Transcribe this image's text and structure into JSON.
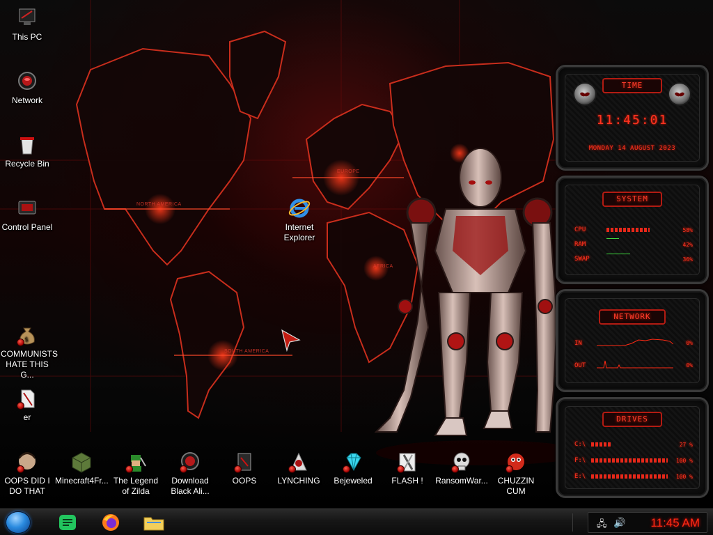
{
  "desktop_icons": [
    {
      "id": "this-pc",
      "label": "This PC",
      "icon": "this-pc-icon"
    },
    {
      "id": "network",
      "label": "Network",
      "icon": "network-icon"
    },
    {
      "id": "recycle-bin",
      "label": "Recycle Bin",
      "icon": "recycle-bin-icon"
    },
    {
      "id": "control-panel",
      "label": "Control Panel",
      "icon": "control-panel-icon"
    },
    {
      "id": "internet-explorer",
      "label": "Internet Explorer",
      "icon": "internet-explorer-icon"
    },
    {
      "id": "communists",
      "label": "COMMUNISTS HATE THIS G...",
      "icon": "money-bag-icon"
    },
    {
      "id": "er",
      "label": "er",
      "icon": "file-icon"
    },
    {
      "id": "oops-did",
      "label": "OOPS DID I DO THAT",
      "icon": "face-icon"
    },
    {
      "id": "minecraft",
      "label": "Minecraft4Fr...",
      "icon": "minecraft-icon"
    },
    {
      "id": "zilda",
      "label": "The Legend of Zilda",
      "icon": "zilda-icon"
    },
    {
      "id": "download-black",
      "label": "Download Black Ali...",
      "icon": "alien-download-icon"
    },
    {
      "id": "oops",
      "label": "OOPS",
      "icon": "oops-icon"
    },
    {
      "id": "lynching",
      "label": "LYNCHING",
      "icon": "lynching-icon"
    },
    {
      "id": "bejeweled",
      "label": "Bejeweled",
      "icon": "gem-icon"
    },
    {
      "id": "flash",
      "label": "FLASH !",
      "icon": "flash-icon"
    },
    {
      "id": "ransomware",
      "label": "RansomWar...",
      "icon": "skull-icon"
    },
    {
      "id": "chuzzin",
      "label": "CHUZZIN CUM",
      "icon": "chuzzle-icon"
    }
  ],
  "wallpaper": {
    "map_labels": [
      "NORTH AMERICA",
      "EUROPE",
      "AFRICA",
      "SOUTH AMERICA"
    ]
  },
  "gadgets": {
    "time": {
      "title": "TIME",
      "clock": "11:45:01",
      "date": "MONDAY 14 AUGUST 2023"
    },
    "system": {
      "title": "SYSTEM",
      "rows": [
        {
          "label": "CPU",
          "value": "58%",
          "level": 0.58
        },
        {
          "label": "RAM",
          "value": "42%",
          "level": 0.42
        },
        {
          "label": "SWAP",
          "value": "36%",
          "level": 0.36
        }
      ]
    },
    "network": {
      "title": "NETWORK",
      "rows": [
        {
          "label": "IN",
          "value": "0%"
        },
        {
          "label": "OUT",
          "value": "0%"
        }
      ]
    },
    "drives": {
      "title": "DRIVES",
      "rows": [
        {
          "label": "C:\\",
          "value": "27 %",
          "level": 0.27
        },
        {
          "label": "F:\\",
          "value": "100 %",
          "level": 1.0
        },
        {
          "label": "E:\\",
          "value": "100 %",
          "level": 1.0
        }
      ]
    }
  },
  "taskbar": {
    "start_icon": "start-orb-icon",
    "pinned": [
      {
        "id": "notes",
        "icon": "green-notes-icon"
      },
      {
        "id": "firefox",
        "icon": "firefox-icon"
      },
      {
        "id": "file-explorer",
        "icon": "folder-icon"
      }
    ],
    "tray": {
      "icons": [
        "network-tray-icon",
        "volume-icon"
      ],
      "clock": "11:45 AM"
    }
  },
  "colors": {
    "accent_red": "#ff2a14",
    "start_blue": "#2a8be0"
  }
}
